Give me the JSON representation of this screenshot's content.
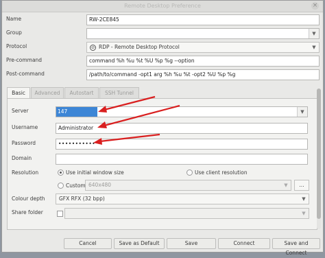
{
  "window": {
    "title": "Remote Desktop Preference",
    "close_glyph": "×"
  },
  "form": {
    "name": {
      "label": "Name",
      "value": "RW-2CE845"
    },
    "group": {
      "label": "Group",
      "value": ""
    },
    "protocol": {
      "label": "Protocol",
      "value": "RDP - Remote Desktop Protocol"
    },
    "pre_command": {
      "label": "Pre-command",
      "value": "command %h %u %t %U %p %g --option"
    },
    "post_command": {
      "label": "Post-command",
      "value": "/path/to/command -opt1 arg %h %u %t -opt2 %U %p %g"
    }
  },
  "tabs": [
    {
      "label": "Basic",
      "active": true
    },
    {
      "label": "Advanced",
      "active": false
    },
    {
      "label": "Autostart",
      "active": false
    },
    {
      "label": "SSH Tunnel",
      "active": false
    }
  ],
  "basic": {
    "server": {
      "label": "Server",
      "value": "147"
    },
    "username": {
      "label": "Username",
      "value": "Administrator"
    },
    "password": {
      "label": "Password",
      "value": "•••••••••••"
    },
    "domain": {
      "label": "Domain",
      "value": ""
    },
    "resolution": {
      "label": "Resolution",
      "initial": "Use initial window size",
      "client": "Use client resolution",
      "custom": "Custom",
      "custom_value": "640x480",
      "more": "..."
    },
    "colour_depth": {
      "label": "Colour depth",
      "value": "GFX RFX (32 bpp)"
    },
    "share_folder": {
      "label": "Share folder",
      "value": ""
    }
  },
  "buttons": {
    "cancel": "Cancel",
    "save_default": "Save as Default",
    "save": "Save",
    "connect": "Connect",
    "save_connect": "Save and Connect"
  },
  "colors": {
    "annotation_arrow": "#d91f1f",
    "selection": "#3d86d6"
  },
  "icons": {
    "protocol": "no-entry-icon",
    "dropdown": "triangle-down-icon"
  }
}
